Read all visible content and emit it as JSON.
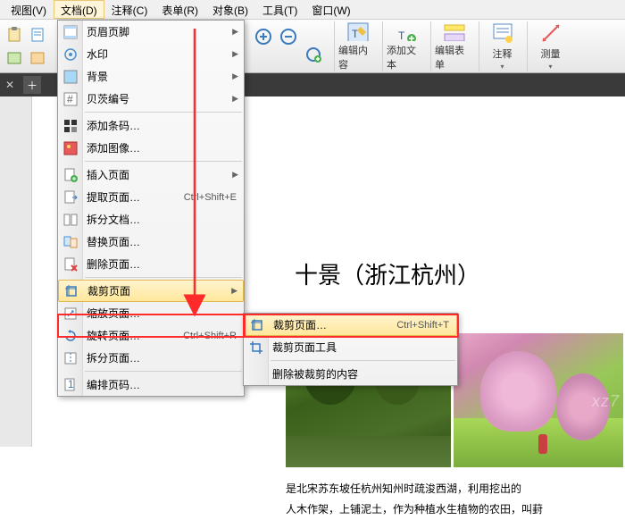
{
  "menubar": {
    "items": [
      "视图(V)",
      "文档(D)",
      "注释(C)",
      "表单(R)",
      "对象(B)",
      "工具(T)",
      "窗口(W)"
    ]
  },
  "toolbar": {
    "edit_content": "编辑内容",
    "add_text": "添加文本",
    "edit_form": "编辑表单",
    "annotate": "注释",
    "measure": "测量"
  },
  "dropdown": {
    "header_footer": "页眉页脚",
    "watermark": "水印",
    "background": "背景",
    "bates": "贝茨编号",
    "add_barcode": "添加条码…",
    "add_image": "添加图像…",
    "insert_page": "插入页面",
    "extract_page": "提取页面…",
    "split_doc": "拆分文档…",
    "replace_page": "替换页面…",
    "delete_page": "删除页面…",
    "crop_page": "裁剪页面",
    "zoom_page": "缩放页面…",
    "rotate_page": "旋转页面…",
    "split_page": "拆分页面…",
    "number_page": "编排页码…",
    "sc_extract": "Ctrl+Shift+E",
    "sc_rotate": "Ctrl+Shift+R"
  },
  "submenu": {
    "crop_page": "裁剪页面…",
    "crop_tool": "裁剪页面工具",
    "remove_crop": "删除被裁剪的内容",
    "sc_crop": "Ctrl+Shift+T"
  },
  "document": {
    "title": "十景（浙江杭州）",
    "body_1": "是北宋苏东坡任杭州知州时疏浚西湖，利用挖出的",
    "body_2": "人木作架，上铺泥土，作为种植水生植物的农田，叫葑"
  }
}
